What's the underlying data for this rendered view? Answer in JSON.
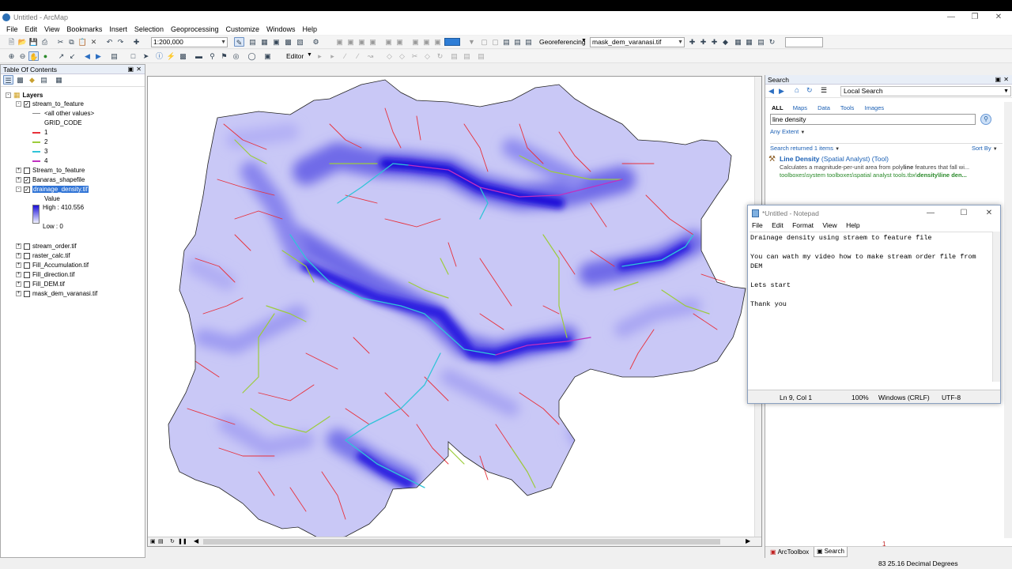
{
  "window": {
    "title": "Untitled - ArcMap"
  },
  "menu": [
    "File",
    "Edit",
    "View",
    "Bookmarks",
    "Insert",
    "Selection",
    "Geoprocessing",
    "Customize",
    "Windows",
    "Help"
  ],
  "toolbar": {
    "scale": "1:200,000",
    "georeferencing_label": "Georeferencing",
    "georef_layer": "mask_dem_varanasi.tif",
    "editor_label": "Editor"
  },
  "toc": {
    "title": "Table Of Contents",
    "root": "Layers",
    "layers": [
      {
        "label": "stream_to_feature",
        "checked": true,
        "expanded": true
      },
      {
        "label": "<all other values>"
      },
      {
        "label": "GRID_CODE"
      },
      {
        "label": "1",
        "color": "#e8303a"
      },
      {
        "label": "2",
        "color": "#9ccc3c"
      },
      {
        "label": "3",
        "color": "#30c4d8"
      },
      {
        "label": "4",
        "color": "#c030c0"
      },
      {
        "label": "Stream_to_feature",
        "checked": false
      },
      {
        "label": "Banaras_shapefile",
        "checked": true
      },
      {
        "label": "drainage_density.tif",
        "checked": true,
        "selected": true
      },
      {
        "label": "Value"
      },
      {
        "label": "High : 410.556"
      },
      {
        "label": "Low : 0"
      },
      {
        "label": "stream_order.tif",
        "checked": false
      },
      {
        "label": "raster_calc.tif",
        "checked": false
      },
      {
        "label": "Fill_Accumulation.tif",
        "checked": false
      },
      {
        "label": "Fill_direction.tif",
        "checked": false
      },
      {
        "label": "Fill_DEM.tif",
        "checked": false
      },
      {
        "label": "mask_dem_varanasi.tif",
        "checked": false
      }
    ]
  },
  "search": {
    "title": "Search",
    "scope": "Local Search",
    "tabs": [
      "ALL",
      "Maps",
      "Data",
      "Tools",
      "Images"
    ],
    "query": "line density",
    "extent": "Any Extent",
    "returned": "Search returned 1 items",
    "sort": "Sort By",
    "result_title": "Line Density",
    "result_sub": "(Spatial Analyst) (Tool)",
    "result_desc_pre": "Calculates a magnitude-per-unit area from poly",
    "result_desc_bold": "line",
    "result_desc_post": " features that fall wi...",
    "result_path_pre": "toolboxes\\system toolboxes\\spatial analyst tools.tbx\\",
    "result_path_bold": "density\\line den...",
    "bottom_tabs": [
      "ArcToolbox",
      "Search"
    ],
    "page_marker": "1"
  },
  "notepad": {
    "title": "*Untitled - Notepad",
    "menu": [
      "File",
      "Edit",
      "Format",
      "View",
      "Help"
    ],
    "text": "Drainage density using straem to feature file\n\nYou can wath my video how to make stream order file from DEM\n\nLets start\n\nThank you",
    "status": {
      "position": "Ln 9, Col 1",
      "zoom": "100%",
      "eol": "Windows (CRLF)",
      "encoding": "UTF-8"
    }
  },
  "statusbar": {
    "coords": "83  25.16 Decimal Degrees"
  }
}
